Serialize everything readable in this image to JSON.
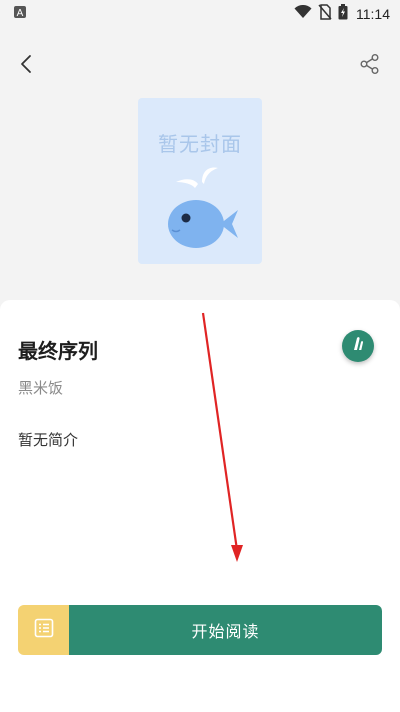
{
  "status_bar": {
    "time": "11:14",
    "icons": [
      "notification-a-icon",
      "wifi-icon",
      "no-sim-icon",
      "battery-charging-icon"
    ]
  },
  "toolbar": {
    "back_icon": "chevron-left-icon",
    "share_icon": "share-icon"
  },
  "cover": {
    "placeholder_text": "暂无封面",
    "bg_color": "#dbe9fb",
    "text_color": "#a9c6ea",
    "fish_color": "#7fb3ef"
  },
  "book": {
    "title": "最终序列",
    "author": "黑米饭",
    "intro": "暂无简介"
  },
  "actions": {
    "toc_icon": "list-icon",
    "start_reading_label": "开始阅读",
    "accent_color": "#2e8b72",
    "toc_color": "#f4d272"
  }
}
